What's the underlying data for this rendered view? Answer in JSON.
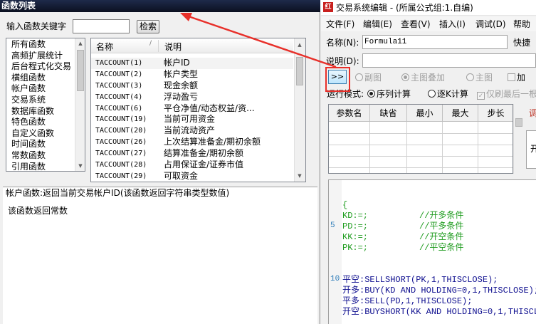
{
  "left": {
    "title": "函数列表",
    "keyword_label": "输入函数关键字",
    "keyword_value": "",
    "search_label": "检索",
    "categories": [
      "所有函数",
      "高频扩展统计",
      "后台程式化交易",
      "横组函数",
      "帐户函数",
      "交易系统",
      "数据库函数",
      "特色函数",
      "自定义函数",
      "时间函数",
      "常数函数",
      "引用函数"
    ],
    "table": {
      "col_name": "名称",
      "col_desc": "说明",
      "sort_glyph": "/",
      "rows": [
        {
          "name": "TACCOUNT(1)",
          "desc": "帐户ID"
        },
        {
          "name": "TACCOUNT(2)",
          "desc": "帐户类型"
        },
        {
          "name": "TACCOUNT(3)",
          "desc": "现金余额"
        },
        {
          "name": "TACCOUNT(4)",
          "desc": "浮动盈亏"
        },
        {
          "name": "TACCOUNT(6)",
          "desc": "平仓净值/动态权益/资..."
        },
        {
          "name": "TACCOUNT(19)",
          "desc": "当前可用资金"
        },
        {
          "name": "TACCOUNT(20)",
          "desc": "当前流动资产"
        },
        {
          "name": "TACCOUNT(26)",
          "desc": "上次结算准备金/期初余额"
        },
        {
          "name": "TACCOUNT(27)",
          "desc": "结算准备金/期初余额"
        },
        {
          "name": "TACCOUNT(28)",
          "desc": "占用保证金/证券市值"
        },
        {
          "name": "TACCOUNT(29)",
          "desc": "可取资金"
        }
      ]
    },
    "desc_line1": "帐户函数:返回当前交易帐户ID(该函数返回字符串类型数值)",
    "desc_line2": "该函数返回常数"
  },
  "right": {
    "title": "交易系统编辑 - (所属公式组:1.自编)",
    "app_icon": "红",
    "menus": [
      "文件(F)",
      "编辑(E)",
      "查看(V)",
      "插入(I)",
      "调试(D)",
      "帮助"
    ],
    "name_label": "名称(N):",
    "name_value": "Formula11",
    "shortcut_label": "快捷",
    "note_label": "说明(D):",
    "note_value": "",
    "expand_label": ">>",
    "opts_row1": {
      "sub_chart": "副图",
      "main_overlay": "主图叠加",
      "main_chart": "主图",
      "add": "加"
    },
    "run_mode_label": "运行模式:",
    "opts_row2": {
      "seq": "序列计算",
      "tick": "逐K计算",
      "last_only": "仅刷最后一根"
    },
    "param_headers": [
      "参数名",
      "缺省",
      "最小",
      "最大",
      "步长"
    ],
    "edge_red": "调",
    "edge_char": "开",
    "code_lines": [
      {
        "ln": "",
        "t": "{"
      },
      {
        "ln": "",
        "t": "KD:=;          //开多条件"
      },
      {
        "ln": "5",
        "t": "PD:=;          //平多条件"
      },
      {
        "ln": "",
        "t": "KK:=;          //开空条件"
      },
      {
        "ln": "",
        "t": "PK:=;          //平空条件"
      },
      {
        "ln": "",
        "t": ""
      },
      {
        "ln": "",
        "t": ""
      },
      {
        "ln": "10",
        "t": "平空:SELLSHORT(PK,1,THISCLOSE);"
      },
      {
        "ln": "",
        "t": "开多:BUY(KD AND HOLDING=0,1,THISCLOSE);"
      },
      {
        "ln": "",
        "t": "平多:SELL(PD,1,THISCLOSE);"
      },
      {
        "ln": "",
        "t": "开空:BUYSHORT(KK AND HOLDING=0,1,THISCL"
      }
    ]
  },
  "colors": {
    "highlight_red": "#e8302a",
    "comment_green": "#1d9b1d",
    "keyword_navy": "#101090"
  }
}
